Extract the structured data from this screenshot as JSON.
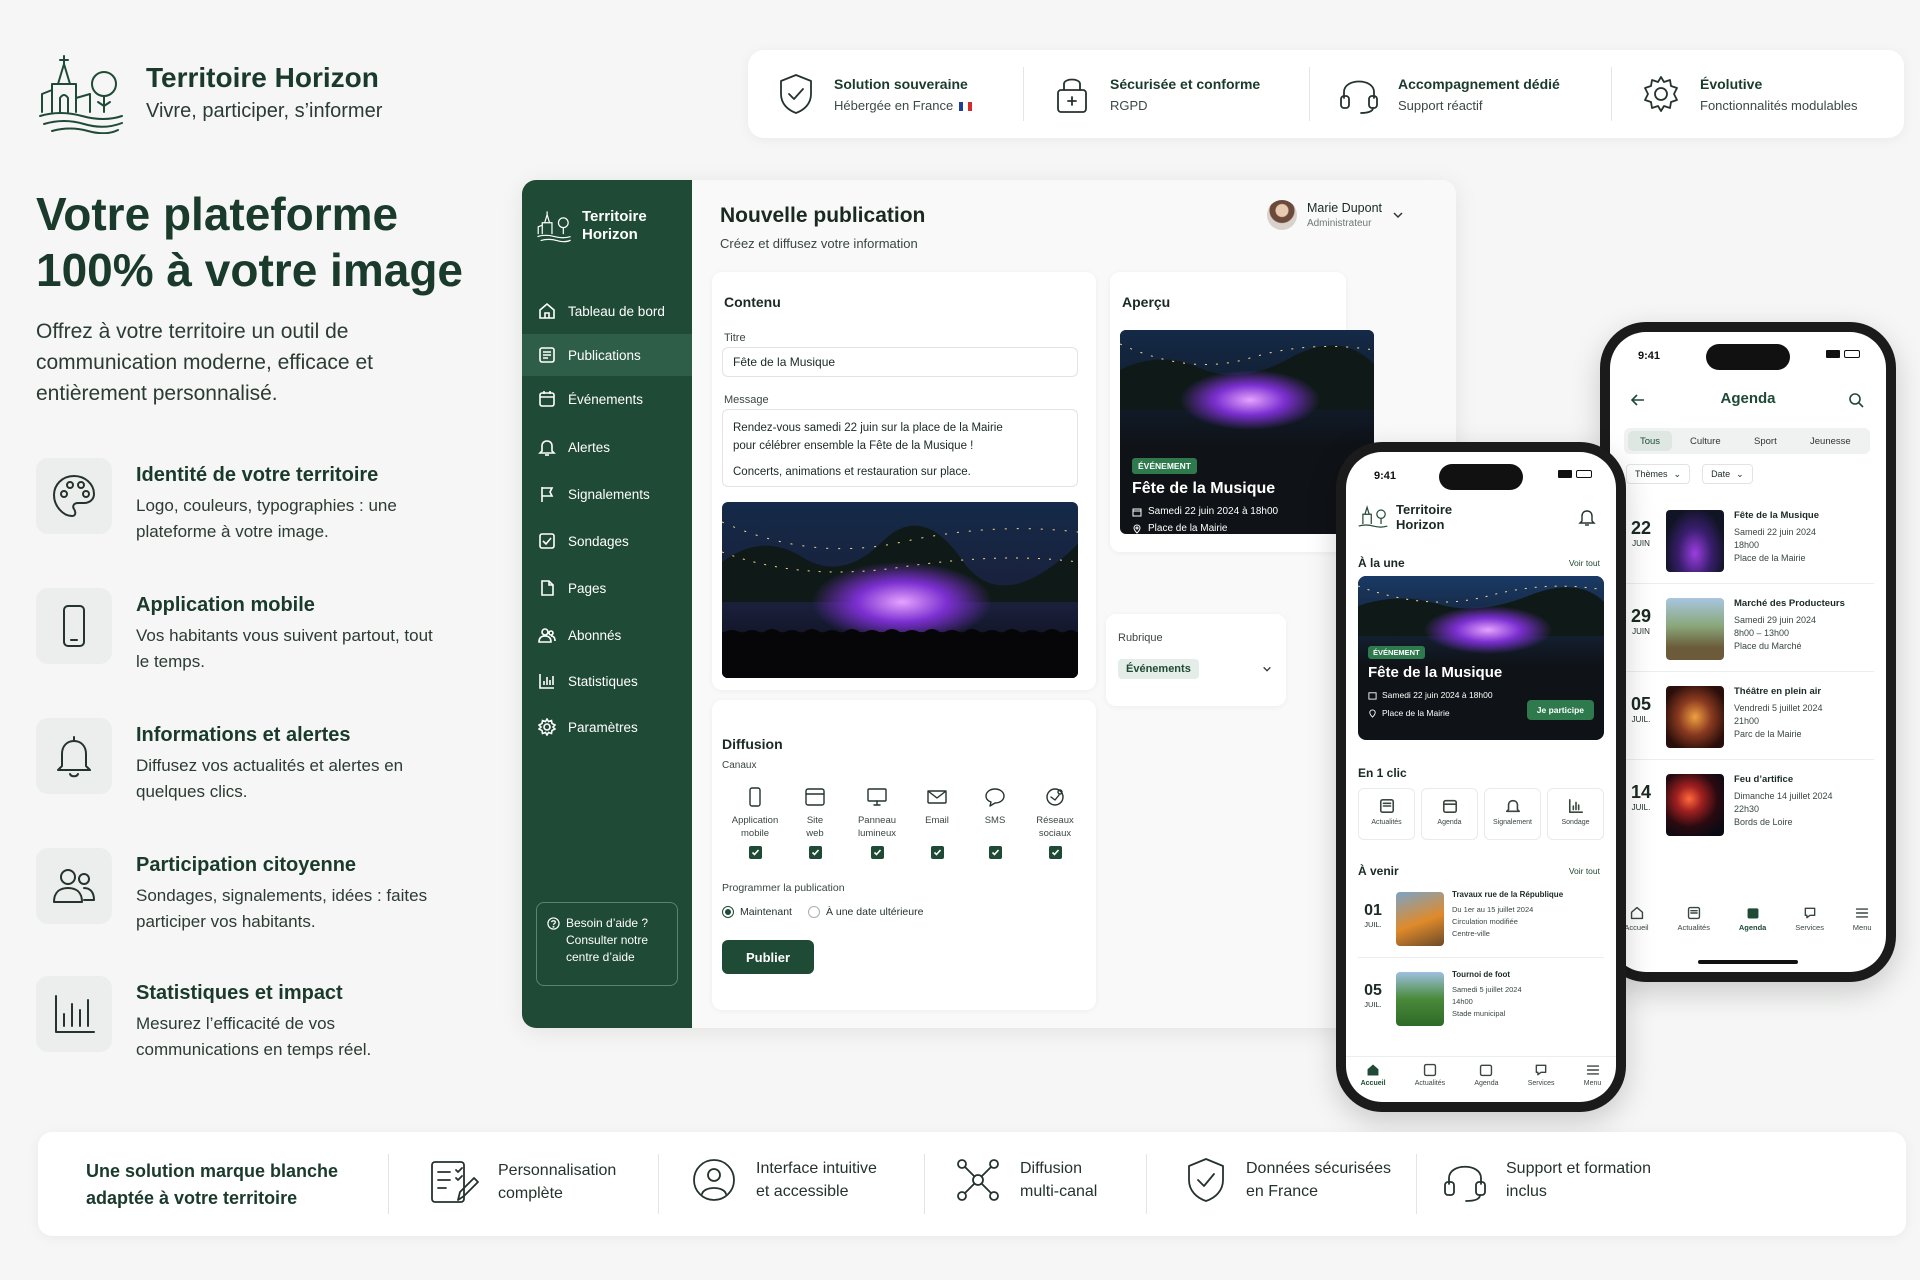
{
  "brand": {
    "name": "Territoire Horizon",
    "tagline": "Vivre, participer, s’informer"
  },
  "top_features": [
    {
      "title": "Solution souveraine",
      "sub": "Hébergée en France",
      "icon": "shield-check-icon"
    },
    {
      "title": "Sécurisée et conforme",
      "sub": "RGPD",
      "icon": "lock-icon"
    },
    {
      "title": "Accompagnement dédié",
      "sub": "Support réactif",
      "icon": "headset-icon"
    },
    {
      "title": "Évolutive",
      "sub": "Fonctionnalités modulables",
      "icon": "gear-icon"
    }
  ],
  "hero": {
    "title_line1": "Votre plateforme",
    "title_line2": "100% à votre image",
    "subtitle": "Offrez à votre territoire un outil de communication moderne, efficace et entièrement personnalisé."
  },
  "features": [
    {
      "title": "Identité de votre territoire",
      "desc": "Logo, couleurs, typographies : une plateforme à votre image.",
      "icon": "palette-icon"
    },
    {
      "title": "Application mobile",
      "desc": "Vos habitants vous suivent partout, tout le temps.",
      "icon": "smartphone-icon"
    },
    {
      "title": "Informations et alertes",
      "desc": "Diffusez vos actualités et alertes en quelques clics.",
      "icon": "bell-icon"
    },
    {
      "title": "Participation citoyenne",
      "desc": "Sondages, signalements, idées : faites participer vos habitants.",
      "icon": "users-icon"
    },
    {
      "title": "Statistiques et impact",
      "desc": "Mesurez l’efficacité de vos communications en temps réel.",
      "icon": "bar-chart-icon"
    }
  ],
  "dashboard": {
    "brand_line1": "Territoire",
    "brand_line2": "Horizon",
    "nav": [
      {
        "label": "Tableau de bord",
        "icon": "home-icon"
      },
      {
        "label": "Publications",
        "icon": "newspaper-icon",
        "active": true
      },
      {
        "label": "Événements",
        "icon": "calendar-icon"
      },
      {
        "label": "Alertes",
        "icon": "bell-icon"
      },
      {
        "label": "Signalements",
        "icon": "flag-icon"
      },
      {
        "label": "Sondages",
        "icon": "checkbox-icon"
      },
      {
        "label": "Pages",
        "icon": "page-icon"
      },
      {
        "label": "Abonnés",
        "icon": "users-icon"
      },
      {
        "label": "Statistiques",
        "icon": "bar-chart-icon"
      },
      {
        "label": "Paramètres",
        "icon": "gear-icon"
      }
    ],
    "help": {
      "title": "Besoin d’aide ?",
      "line1": "Consulter notre",
      "line2": "centre d’aide"
    },
    "page_title": "Nouvelle publication",
    "page_subtitle": "Créez et diffusez votre information",
    "user": {
      "name": "Marie Dupont",
      "role": "Administrateur"
    },
    "content": {
      "heading": "Contenu",
      "title_label": "Titre",
      "title_value": "Fête de la Musique",
      "message_label": "Message",
      "message_line1": "Rendez-vous samedi 22 juin sur la place de la Mairie",
      "message_line2": "pour célébrer ensemble la Fête de la Musique !",
      "message_line3": "Concerts, animations et restauration sur place."
    },
    "preview": {
      "heading": "Aperçu",
      "badge": "ÉVÉNEMENT",
      "title": "Fête de la Musique",
      "date": "Samedi 22 juin 2024 à 18h00",
      "place": "Place de la Mairie"
    },
    "rubrique": {
      "label": "Rubrique",
      "value": "Événements"
    },
    "diffusion": {
      "heading": "Diffusion",
      "channels_label": "Canaux",
      "channels": [
        {
          "l1": "Application",
          "l2": "mobile",
          "icon": "smartphone-icon"
        },
        {
          "l1": "Site",
          "l2": "web",
          "icon": "browser-icon"
        },
        {
          "l1": "Panneau",
          "l2": "lumineux",
          "icon": "monitor-icon"
        },
        {
          "l1": "Email",
          "l2": "",
          "icon": "mail-icon"
        },
        {
          "l1": "SMS",
          "l2": "",
          "icon": "chat-icon"
        },
        {
          "l1": "Réseaux",
          "l2": "sociaux",
          "icon": "share-icon"
        }
      ],
      "schedule_label": "Programmer la publication",
      "option_now": "Maintenant",
      "option_later": "À une date ultérieure",
      "publish": "Publier"
    }
  },
  "phone_home": {
    "time": "9:41",
    "brand_line1": "Territoire",
    "brand_line2": "Horizon",
    "featured_heading": "À la une",
    "see_all": "Voir tout",
    "card": {
      "badge": "ÉVÉNEMENT",
      "title": "Fête de la Musique",
      "date": "Samedi 22 juin 2024 à 18h00",
      "place": "Place de la Mairie",
      "cta": "Je participe"
    },
    "quick_heading": "En 1 clic",
    "quick": [
      {
        "label": "Actualités",
        "icon": "newspaper-icon"
      },
      {
        "label": "Agenda",
        "icon": "calendar-icon"
      },
      {
        "label": "Signalement",
        "icon": "bell-icon"
      },
      {
        "label": "Sondage",
        "icon": "bar-chart-icon"
      }
    ],
    "upcoming_heading": "À venir",
    "upcoming_see_all": "Voir tout",
    "upcoming": [
      {
        "day": "01",
        "month": "JUIL.",
        "title": "Travaux rue de la République",
        "l1": "Du 1er au 15 juillet 2024",
        "l2": "Circulation modifiée",
        "l3": "Centre-ville"
      },
      {
        "day": "05",
        "month": "JUIL.",
        "title": "Tournoi de foot",
        "l1": "Samedi 5 juillet 2024",
        "l2": "14h00",
        "l3": "Stade municipal"
      }
    ],
    "tabs": [
      "Accueil",
      "Actualités",
      "Agenda",
      "Services",
      "Menu"
    ]
  },
  "phone_agenda": {
    "time": "9:41",
    "title": "Agenda",
    "filters": [
      "Tous",
      "Culture",
      "Sport",
      "Jeunesse"
    ],
    "dropdowns": [
      "Thèmes",
      "Date"
    ],
    "events": [
      {
        "day": "22",
        "month": "JUIN",
        "title": "Fête de la Musique",
        "l1": "Samedi 22 juin 2024",
        "l2": "18h00",
        "l3": "Place de la Mairie"
      },
      {
        "day": "29",
        "month": "JUIN",
        "title": "Marché des Producteurs",
        "l1": "Samedi 29 juin 2024",
        "l2": "8h00 – 13h00",
        "l3": "Place du Marché"
      },
      {
        "day": "05",
        "month": "JUIL.",
        "title": "Théâtre en plein air",
        "l1": "Vendredi 5 juillet 2024",
        "l2": "21h00",
        "l3": "Parc de la Mairie"
      },
      {
        "day": "14",
        "month": "JUIL.",
        "title": "Feu d’artifice",
        "l1": "Dimanche 14 juillet 2024",
        "l2": "22h30",
        "l3": "Bords de Loire"
      }
    ],
    "tabs": [
      "Accueil",
      "Actualités",
      "Agenda",
      "Services",
      "Menu"
    ]
  },
  "bottom": {
    "title_line1": "Une solution marque blanche",
    "title_line2": "adaptée à votre territoire",
    "items": [
      {
        "l1": "Personnalisation",
        "l2": "complète",
        "icon": "edit-form-icon"
      },
      {
        "l1": "Interface intuitive",
        "l2": "et accessible",
        "icon": "user-circle-icon"
      },
      {
        "l1": "Diffusion",
        "l2": "multi-canal",
        "icon": "network-icon"
      },
      {
        "l1": "Données sécurisées",
        "l2": "en France",
        "icon": "shield-check-icon"
      },
      {
        "l1": "Support et formation",
        "l2": "inclus",
        "icon": "headset-icon"
      }
    ]
  },
  "colors": {
    "primary": "#1f4a35",
    "primary_light": "#2e5e47",
    "background": "#f5f6f5"
  }
}
